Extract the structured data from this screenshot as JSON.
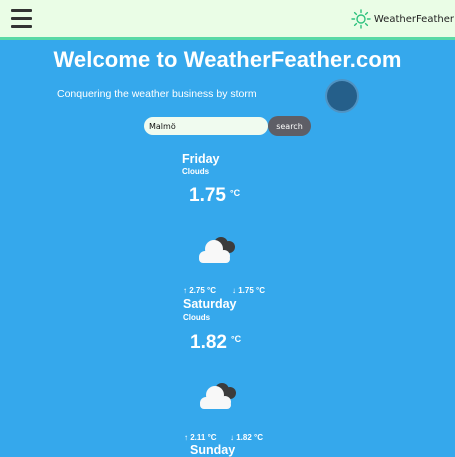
{
  "header": {
    "brand_name": "WeatherFeather",
    "brand_icon": "sun-icon",
    "menu_icon": "hamburger-menu-icon"
  },
  "hero": {
    "title": "Welcome to WeatherFeather.com",
    "tagline": "Conquering the weather business by storm"
  },
  "search": {
    "value": "Malmö",
    "button_label": "search"
  },
  "forecast": [
    {
      "day": "Friday",
      "description": "Clouds",
      "temp": "1.75",
      "unit": "°C",
      "icon": "clouds-icon",
      "max": "↑ 2.75 °C",
      "min": "↓ 1.75 °C"
    },
    {
      "day": "Saturday",
      "description": "Clouds",
      "temp": "1.82",
      "unit": "°C",
      "icon": "clouds-icon",
      "max": "↑ 2.11 °C",
      "min": "↓ 1.82 °C"
    },
    {
      "day": "Sunday"
    }
  ],
  "colors": {
    "background": "#35a8ec",
    "header_bg": "#eafde6",
    "header_border": "#59d9a6",
    "brand_icon": "#2ec27e",
    "button_bg": "#5e5e66"
  }
}
